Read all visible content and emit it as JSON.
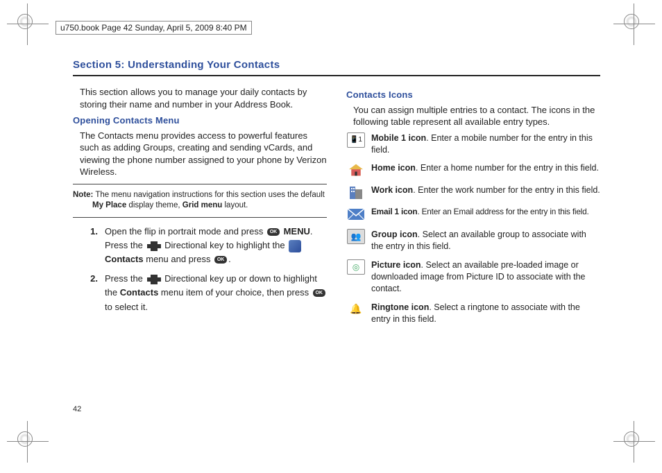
{
  "header": {
    "stamp": "u750.book  Page 42  Sunday, April 5, 2009  8:40 PM"
  },
  "section_title": "Section 5: Understanding Your Contacts",
  "page_number": "42",
  "left_col": {
    "intro": "This section allows you to manage your daily contacts by storing their name and number in your Address Book.",
    "heading1": "Opening Contacts Menu",
    "body1": "The Contacts menu provides access to powerful features such as adding Groups, creating and sending vCards, and viewing the phone number assigned to your phone by Verizon Wireless.",
    "note_label": "Note:",
    "note_text_a": " The menu navigation instructions for this section uses the default ",
    "note_text_b": "My Place",
    "note_text_c": " display theme, ",
    "note_text_d": "Grid menu",
    "note_text_e": " layout.",
    "steps": [
      {
        "num": "1.",
        "parts": {
          "a": "Open the flip in portrait mode and press ",
          "menu": " MENU",
          "b": ". Press the ",
          "c": " Directional key to highlight the ",
          "contacts": " Contacts",
          "d": " menu and press ",
          "e": "."
        }
      },
      {
        "num": "2.",
        "parts": {
          "a": "Press the ",
          "b": " Directional key up or down to highlight the ",
          "contacts": "Contacts",
          "c": " menu item of your choice, then press ",
          "d": " to select it."
        }
      }
    ]
  },
  "right_col": {
    "heading": "Contacts Icons",
    "intro": "You can assign multiple entries to a contact. The icons in the following table represent all available entry types.",
    "icons": [
      {
        "name": "Mobile 1 icon",
        "desc": ". Enter a mobile number for the entry in this field."
      },
      {
        "name": "Home icon",
        "desc": ". Enter a home number for the entry in this field."
      },
      {
        "name": "Work icon",
        "desc": ". Enter the work number for the entry in this field."
      },
      {
        "name": "Email 1 icon",
        "desc": ". Enter an Email address for the entry in this field."
      },
      {
        "name": "Group icon",
        "desc": ". Select an available group to associate with the entry in this field."
      },
      {
        "name": "Picture icon",
        "desc": ". Select an available pre-loaded image or downloaded image from Picture ID to associate with the contact."
      },
      {
        "name": "Ringtone icon",
        "desc": ". Select a ringtone to associate with the entry in this field."
      }
    ]
  }
}
